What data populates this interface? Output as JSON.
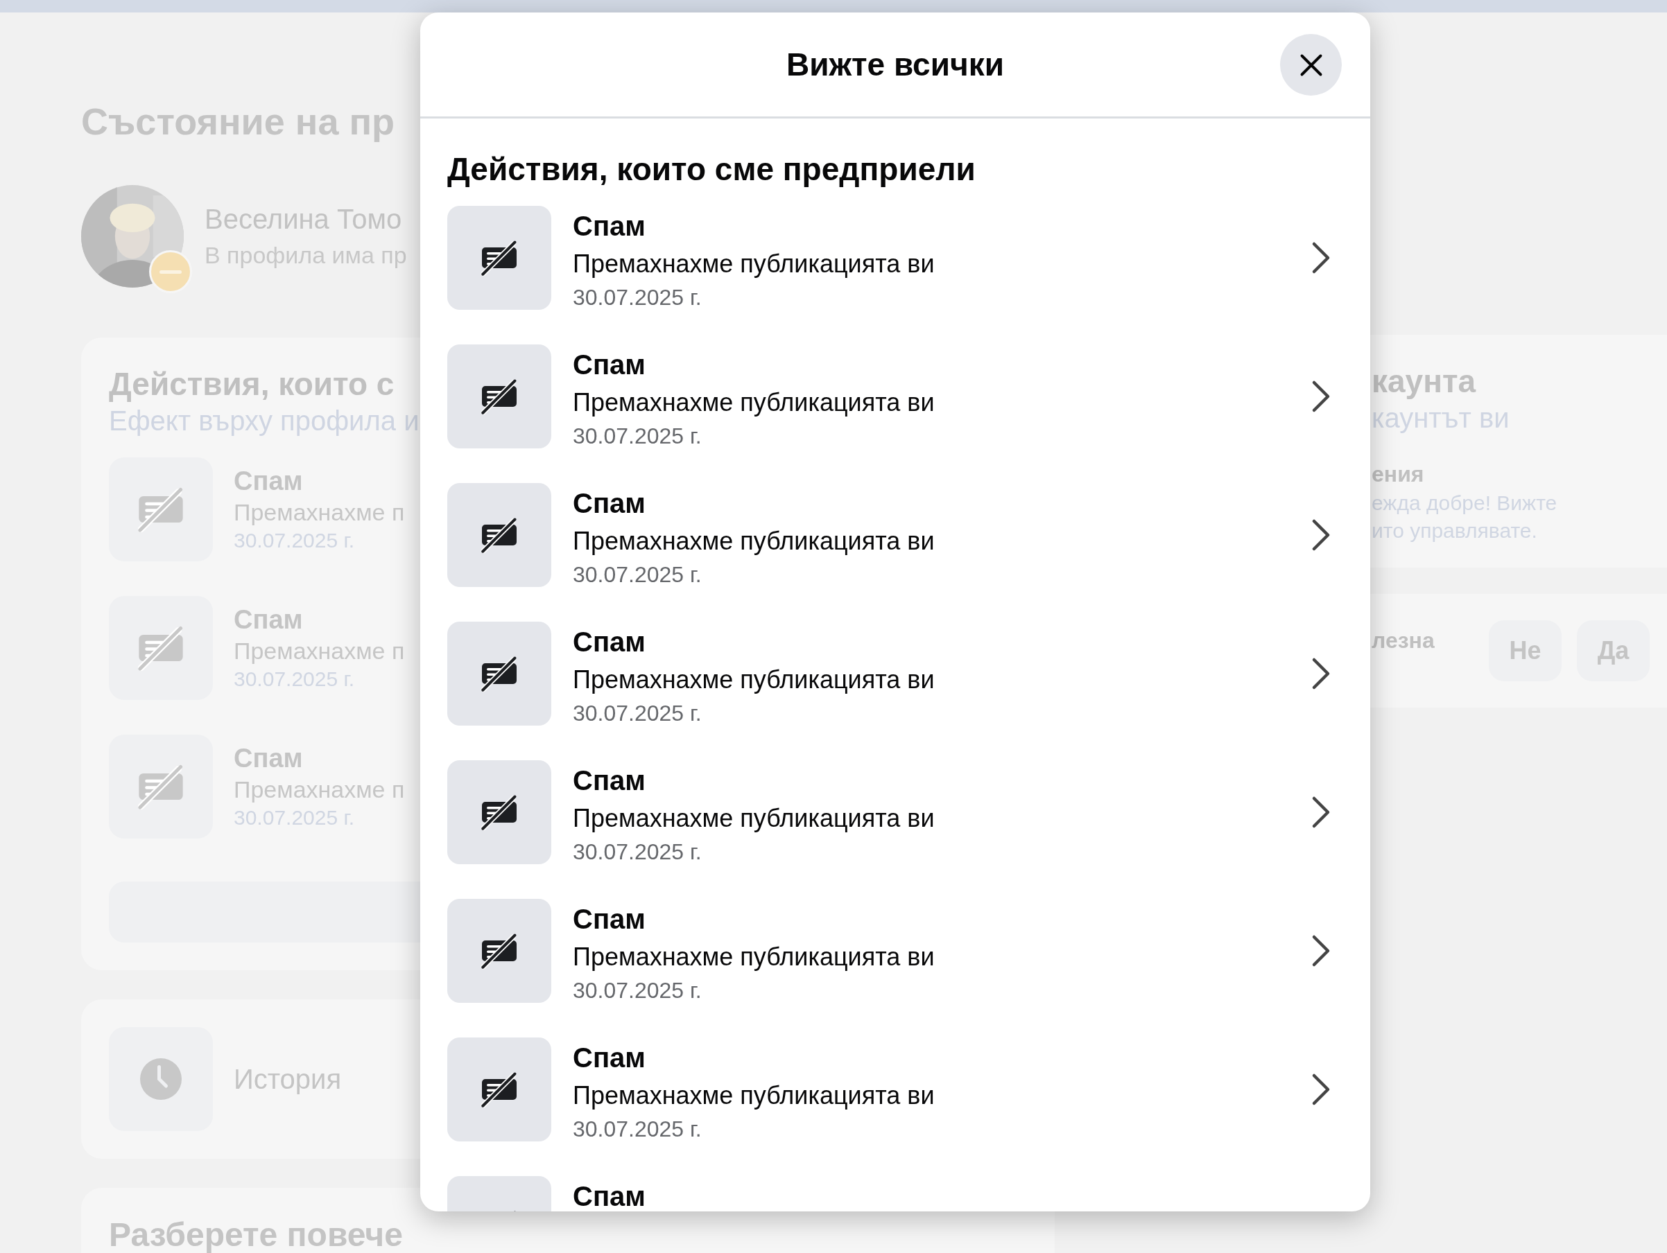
{
  "background": {
    "page_title": "Състояние на пр",
    "profile": {
      "name": "Веселина Томо",
      "status": "В профила има пр"
    },
    "actions_card": {
      "title": "Действия, които с",
      "subtitle": "Ефект върху профила и",
      "items": [
        {
          "title": "Спам",
          "description": "Премахнахме п",
          "date": "30.07.2025 г."
        },
        {
          "title": "Спам",
          "description": "Премахнахме п",
          "date": "30.07.2025 г."
        },
        {
          "title": "Спам",
          "description": "Премахнахме п",
          "date": "30.07.2025 г."
        }
      ]
    },
    "history_card": {
      "label": "История"
    },
    "learn_more_card": {
      "title": "Разберете повече"
    },
    "account_card": {
      "title": "каунта",
      "subtitle": "каунтът ви",
      "section_title": "ения",
      "section_lines": [
        "ежда добре! Вижте",
        "ито управлявате."
      ]
    },
    "feedback_card": {
      "question": "лезна",
      "buttons": [
        "Не",
        "Да"
      ]
    }
  },
  "modal": {
    "title": "Вижте всички",
    "section_title": "Действия, които сме предприели",
    "items": [
      {
        "title": "Спам",
        "description": "Премахнахме публикацията ви",
        "date": "30.07.2025 г."
      },
      {
        "title": "Спам",
        "description": "Премахнахме публикацията ви",
        "date": "30.07.2025 г."
      },
      {
        "title": "Спам",
        "description": "Премахнахме публикацията ви",
        "date": "30.07.2025 г."
      },
      {
        "title": "Спам",
        "description": "Премахнахме публикацията ви",
        "date": "30.07.2025 г."
      },
      {
        "title": "Спам",
        "description": "Премахнахме публикацията ви",
        "date": "30.07.2025 г."
      },
      {
        "title": "Спам",
        "description": "Премахнахме публикацията ви",
        "date": "30.07.2025 г."
      },
      {
        "title": "Спам",
        "description": "Премахнахме публикацията ви",
        "date": "30.07.2025 г."
      },
      {
        "title": "Спам"
      }
    ]
  }
}
